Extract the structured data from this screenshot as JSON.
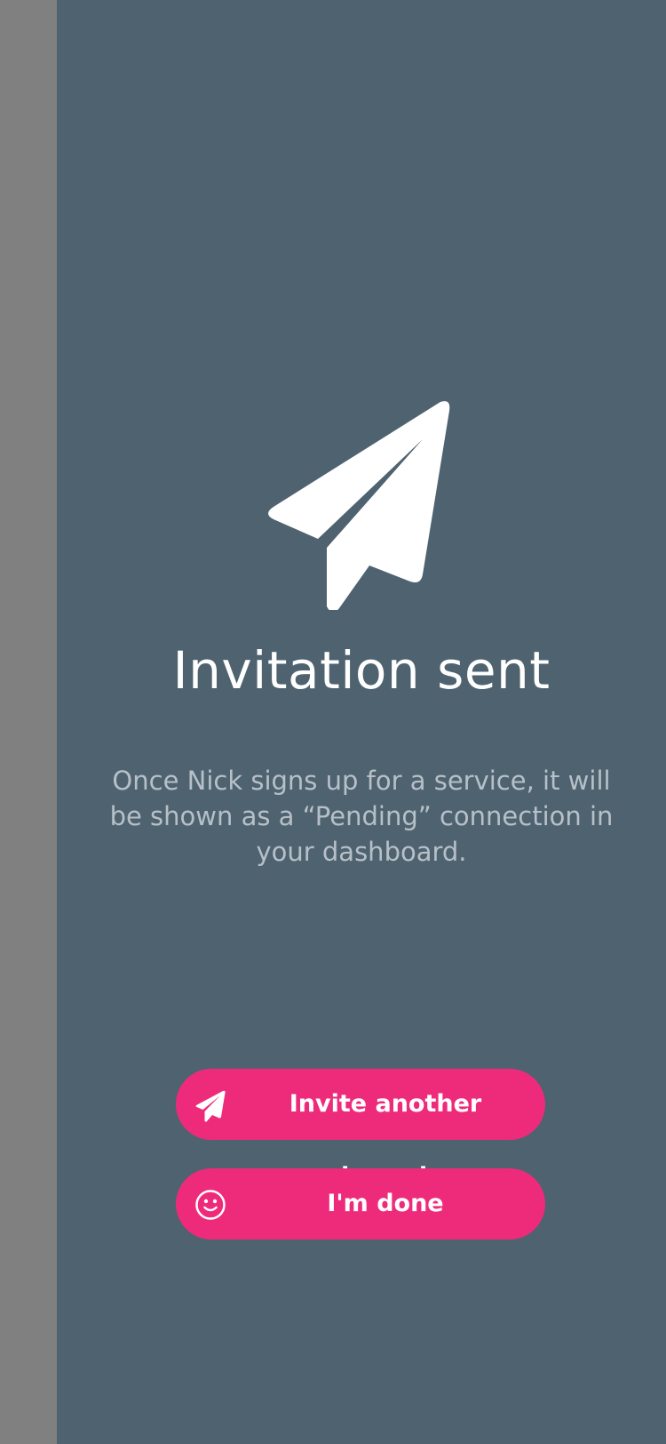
{
  "screen": {
    "title": "Invitation sent",
    "message": "Once Nick signs up for a service, it will be shown as a “Pending” connection in your dashboard.",
    "hero_icon": "paper-plane-icon"
  },
  "actions": {
    "invite_label": "Invite another tenant",
    "invite_icon": "paper-plane-icon",
    "done_label": "I'm done",
    "done_icon": "smiley-icon"
  },
  "colors": {
    "panel_background": "#4e6270",
    "side_strip": "#808080",
    "button_accent": "#ee2b7b",
    "title_text": "#ffffff",
    "message_text": "#b7c0c7"
  }
}
